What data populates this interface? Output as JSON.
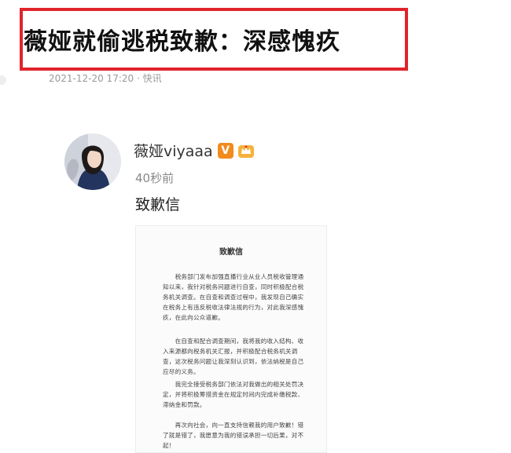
{
  "article": {
    "headline": "薇娅就偷逃税致歉：深感愧疚",
    "meta": "2021-12-20 17:20 · 快讯"
  },
  "post": {
    "username": "薇娅viyaaa",
    "verified_badge": "V",
    "time": "40秒前",
    "text": "致歉信",
    "icons": [
      "avatar",
      "verified-v-icon",
      "crown-badge-icon"
    ]
  },
  "letter": {
    "title": "致歉信",
    "paragraphs": [
      "　　税务部门发布加强直播行业从业人员税收管理通知以来，我针对税务问题进行自查，同时积极配合税务机关调查。在自查和调查过程中，我发现自己确实在税务上有违反税收法律法规的行为，对此我深感愧疚，在此向公众道歉。",
      "　　在自查和配合调查期间，我将我的收入结构、收入来源都向税务机关汇报，并积极配合税务机关调查，这次税务问题让我深刻认识到，依法纳税是自己应尽的义务。",
      "　　我完全接受税务部门依法对我做出的相关处罚决定，并将积极筹措资金在规定时间内完成补缴税款、滞纳金和罚款。",
      "　　再次向社会，向一直支持信赖我的用户致歉！错了就是错了，我愿意为我的错误承担一切后果，对不起！"
    ]
  },
  "colors": {
    "highlight_border": "#e0242b",
    "v_badge": "#f28a1c",
    "crown_badge": "#f4b13b"
  }
}
